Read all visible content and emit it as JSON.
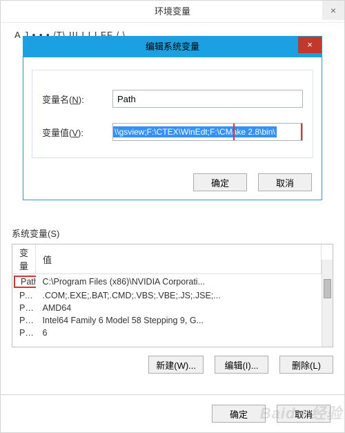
{
  "outer": {
    "title": "环境变量",
    "close": "×",
    "truncated_header": "A  J       •   • •  /T\\   III   I   I  I FF  /     \\"
  },
  "inner": {
    "title": "编辑系统变量",
    "close": "×",
    "name_label_pre": "变量名(",
    "name_label_u": "N",
    "name_label_post": "):",
    "name_value": "Path",
    "value_label_pre": "变量值(",
    "value_label_u": "V",
    "value_label_post": "):",
    "value_value": "\\\\gsview;F:\\CTEX\\WinEdt;F:\\CMake 2.8\\bin\\",
    "ok": "确定",
    "cancel": "取消"
  },
  "sys": {
    "group_label": "系统变量(S)",
    "col_var": "变量",
    "col_val": "值",
    "rows": [
      {
        "var": "Path",
        "val": "C:\\Program Files (x86)\\NVIDIA Corporati..."
      },
      {
        "var": "PATHEXT",
        "val": ".COM;.EXE;.BAT;.CMD;.VBS;.VBE;.JS;.JSE;..."
      },
      {
        "var": "PROCESSOR_ARC...",
        "val": "AMD64"
      },
      {
        "var": "PROCESSOR_IDE...",
        "val": "Intel64 Family 6 Model 58 Stepping 9, G..."
      },
      {
        "var": "PROCESSOR_LEV...",
        "val": "6"
      }
    ],
    "new_btn": "新建(W)...",
    "edit_btn": "编辑(I)...",
    "del_btn": "删除(L)"
  },
  "bottom": {
    "ok": "确定",
    "cancel": "取消"
  },
  "watermark": "Baidu 经验"
}
